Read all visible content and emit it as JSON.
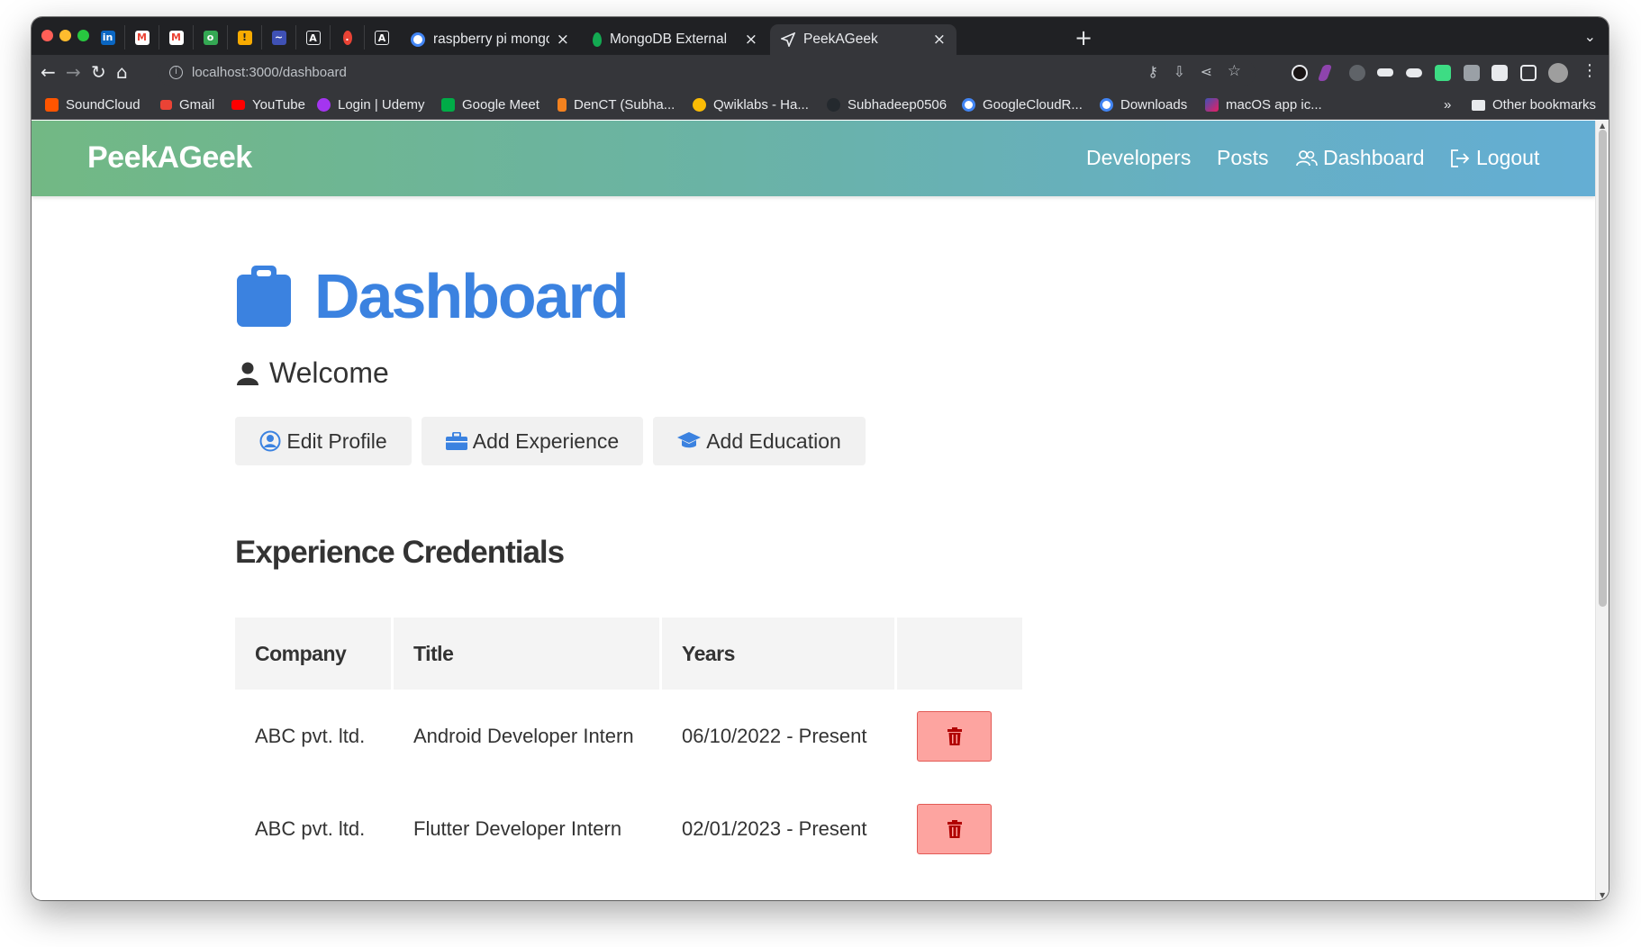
{
  "browser": {
    "tabs": [
      {
        "title": "raspberry pi mongodb on",
        "active": false
      },
      {
        "title": "MongoDB External",
        "active": false
      },
      {
        "title": "PeekAGeek",
        "active": true
      }
    ],
    "pinned_tabs": [
      "linkedin-icon",
      "gmail-icon",
      "gmail-icon",
      "app-icon",
      "key-icon",
      "app-icon",
      "angular-icon",
      "app-icon",
      "angular-icon"
    ],
    "url": "localhost:3000/dashboard",
    "bookmarks": [
      {
        "label": "SoundCloud",
        "icon": "soundcloud-icon",
        "color": "#ff5500"
      },
      {
        "label": "Gmail",
        "icon": "gmail-icon",
        "color": "#ea4335"
      },
      {
        "label": "YouTube",
        "icon": "youtube-icon",
        "color": "#ff0000"
      },
      {
        "label": "Login | Udemy",
        "icon": "udemy-icon",
        "color": "#a435f0"
      },
      {
        "label": "Google Meet",
        "icon": "meet-icon",
        "color": "#00ac47"
      },
      {
        "label": "DenCT (Subha...",
        "icon": "app-icon",
        "color": "#f4821f"
      },
      {
        "label": "Qwiklabs - Ha...",
        "icon": "cloud-icon",
        "color": "#fbbc05"
      },
      {
        "label": "Subhadeep0506",
        "icon": "github-icon",
        "color": "#24292e"
      },
      {
        "label": "GoogleCloudR...",
        "icon": "google-icon",
        "color": "#4285f4"
      },
      {
        "label": "Downloads",
        "icon": "google-icon",
        "color": "#4285f4"
      },
      {
        "label": "macOS app ic...",
        "icon": "app-icon",
        "color": "#c2185b"
      }
    ],
    "bookmarks_more": "»",
    "other_bookmarks": "Other bookmarks"
  },
  "navbar": {
    "brand": "PeekAGeek",
    "links": {
      "developers": "Developers",
      "posts": "Posts",
      "dashboard": "Dashboard",
      "logout": "Logout"
    }
  },
  "main": {
    "title": "Dashboard",
    "welcome": "Welcome",
    "actions": {
      "edit_profile": "Edit Profile",
      "add_experience": "Add Experience",
      "add_education": "Add Education"
    },
    "experience": {
      "heading": "Experience Credentials",
      "columns": [
        "Company",
        "Title",
        "Years"
      ],
      "rows": [
        {
          "company": "ABC pvt. ltd.",
          "title": "Android Developer Intern",
          "years": "06/10/2022 - Present"
        },
        {
          "company": "ABC pvt. ltd.",
          "title": "Flutter Developer Intern",
          "years": "02/01/2023 - Present"
        }
      ]
    }
  },
  "colors": {
    "accent": "#3b82e0",
    "delete_bg": "#fda4a0",
    "delete_icon": "#b00000"
  }
}
